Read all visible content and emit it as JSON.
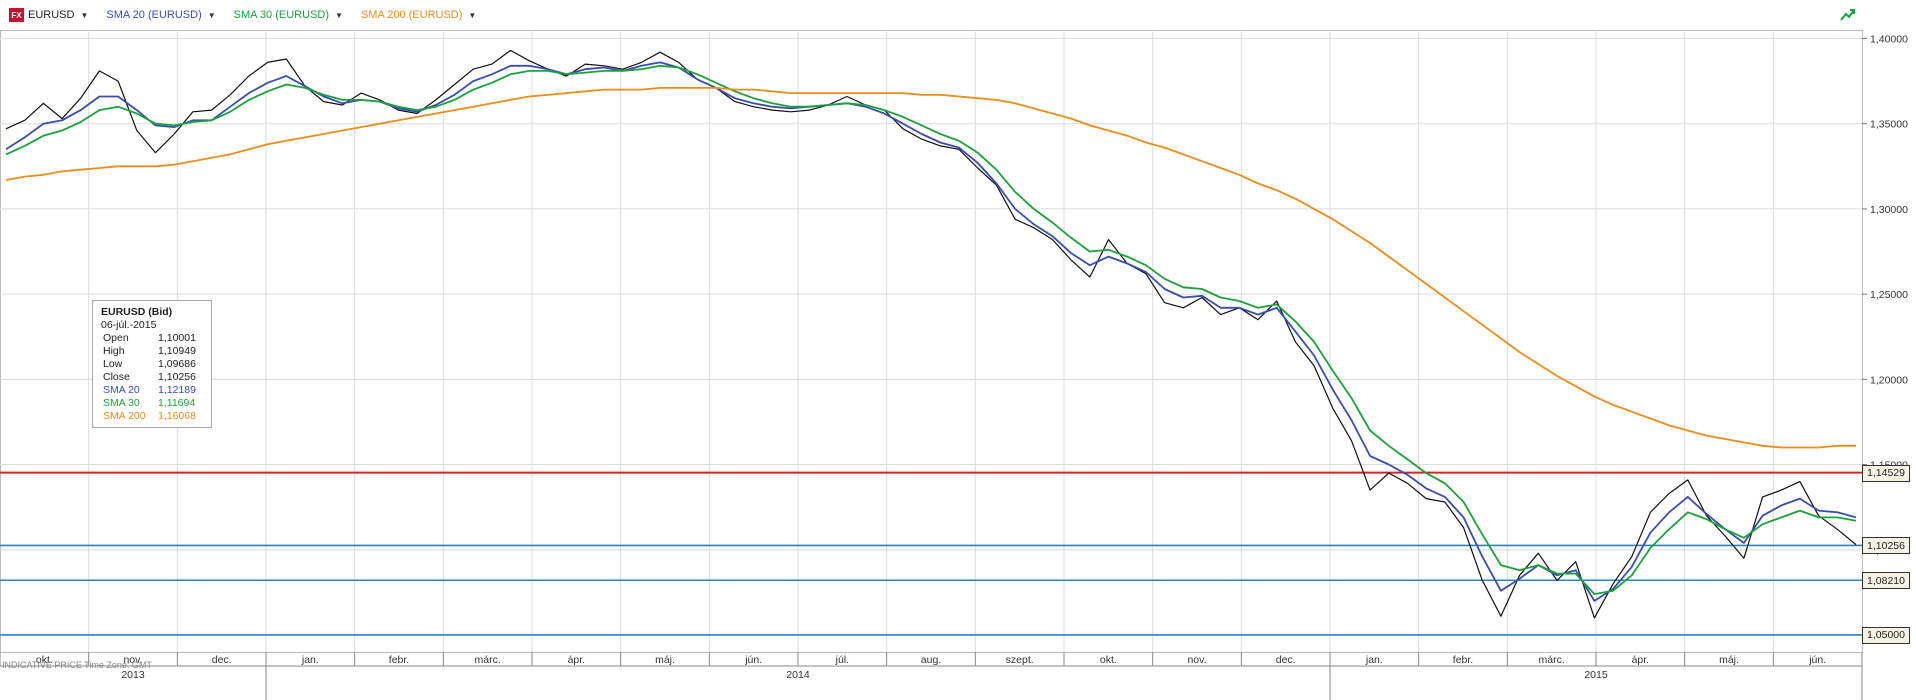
{
  "toolbar": {
    "symbol_icon": "fx-icon",
    "symbol": "EURUSD",
    "sma20_label": "SMA 20 (EURUSD)",
    "sma30_label": "SMA 30 (EURUSD)",
    "sma200_label": "SMA 200 (EURUSD)",
    "trend_icon": "trend-arrow-icon"
  },
  "colors": {
    "price": "#111111",
    "sma20": "#3a4db5",
    "sma30": "#1aa33a",
    "sma200": "#ee8c1a",
    "resistance": "#e02020",
    "support": "#2a84c0",
    "grid": "#dcdcdc"
  },
  "infobox": {
    "title": "EURUSD (Bid)",
    "date": "06-júl.-2015",
    "rows": [
      {
        "k": "Open",
        "v": "1,10001",
        "color": "#222222"
      },
      {
        "k": "High",
        "v": "1,10949",
        "color": "#222222"
      },
      {
        "k": "Low",
        "v": "1,09686",
        "color": "#222222"
      },
      {
        "k": "Close",
        "v": "1,10256",
        "color": "#222222"
      },
      {
        "k": "SMA 20",
        "v": "1,12189",
        "color": "#3a4db5"
      },
      {
        "k": "SMA 30",
        "v": "1,11694",
        "color": "#1aa33a"
      },
      {
        "k": "SMA 200",
        "v": "1,16068",
        "color": "#ee8c1a"
      }
    ]
  },
  "status_text": "INDICATIVE PRICE   Time Zone: GMT",
  "price_tags": [
    "1,14529",
    "1,10256",
    "1,08210",
    "1,05000"
  ],
  "chart_data": {
    "type": "line",
    "ylim": [
      1.04,
      1.405
    ],
    "y_ticks": [
      "1,40000",
      "1,35000",
      "1,30000",
      "1,25000",
      "1,20000",
      "1,15000",
      "1,10000",
      "1,05000"
    ],
    "y_tick_values": [
      1.4,
      1.35,
      1.3,
      1.25,
      1.2,
      1.15,
      1.1,
      1.05
    ],
    "months": [
      "okt.",
      "nov.",
      "dec.",
      "jan.",
      "febr.",
      "márc.",
      "ápr.",
      "máj.",
      "jún.",
      "júl.",
      "aug.",
      "szept.",
      "okt.",
      "nov.",
      "dec.",
      "jan.",
      "febr.",
      "márc.",
      "ápr.",
      "máj.",
      "jún."
    ],
    "years": [
      "2013",
      "2014",
      "2015"
    ],
    "horizontal_lines": [
      {
        "name": "resistance",
        "value": 1.14529,
        "color": "#e02020"
      },
      {
        "name": "last-close",
        "value": 1.10256,
        "color": "#2a84c0"
      },
      {
        "name": "support-1",
        "value": 1.0821,
        "color": "#2a84c0"
      },
      {
        "name": "support-2",
        "value": 1.05,
        "color": "#2a84c0"
      }
    ],
    "series": [
      {
        "key": "price",
        "values": [
          1.347,
          1.352,
          1.362,
          1.353,
          1.365,
          1.381,
          1.375,
          1.346,
          1.333,
          1.344,
          1.357,
          1.358,
          1.367,
          1.378,
          1.386,
          1.388,
          1.372,
          1.363,
          1.361,
          1.368,
          1.364,
          1.358,
          1.356,
          1.364,
          1.373,
          1.382,
          1.385,
          1.393,
          1.387,
          1.382,
          1.378,
          1.385,
          1.384,
          1.382,
          1.386,
          1.392,
          1.386,
          1.376,
          1.371,
          1.363,
          1.36,
          1.358,
          1.357,
          1.358,
          1.361,
          1.366,
          1.361,
          1.358,
          1.347,
          1.341,
          1.337,
          1.335,
          1.324,
          1.314,
          1.294,
          1.289,
          1.282,
          1.27,
          1.26,
          1.282,
          1.268,
          1.262,
          1.245,
          1.242,
          1.248,
          1.238,
          1.242,
          1.235,
          1.246,
          1.222,
          1.208,
          1.183,
          1.164,
          1.135,
          1.145,
          1.139,
          1.13,
          1.128,
          1.113,
          1.082,
          1.061,
          1.085,
          1.098,
          1.082,
          1.093,
          1.06,
          1.08,
          1.096,
          1.122,
          1.133,
          1.141,
          1.12,
          1.108,
          1.095,
          1.131,
          1.135,
          1.14,
          1.12,
          1.112,
          1.103
        ]
      },
      {
        "key": "sma20",
        "values": [
          1.335,
          1.342,
          1.35,
          1.352,
          1.358,
          1.366,
          1.366,
          1.358,
          1.349,
          1.348,
          1.352,
          1.352,
          1.36,
          1.368,
          1.374,
          1.378,
          1.372,
          1.366,
          1.362,
          1.364,
          1.363,
          1.359,
          1.357,
          1.361,
          1.367,
          1.375,
          1.379,
          1.384,
          1.384,
          1.382,
          1.379,
          1.382,
          1.383,
          1.381,
          1.384,
          1.386,
          1.383,
          1.376,
          1.371,
          1.365,
          1.362,
          1.36,
          1.359,
          1.36,
          1.361,
          1.362,
          1.36,
          1.356,
          1.35,
          1.344,
          1.339,
          1.336,
          1.327,
          1.315,
          1.3,
          1.291,
          1.284,
          1.274,
          1.267,
          1.272,
          1.268,
          1.263,
          1.253,
          1.248,
          1.249,
          1.242,
          1.242,
          1.238,
          1.242,
          1.228,
          1.214,
          1.194,
          1.176,
          1.155,
          1.15,
          1.144,
          1.136,
          1.131,
          1.119,
          1.096,
          1.076,
          1.083,
          1.091,
          1.085,
          1.088,
          1.07,
          1.077,
          1.09,
          1.11,
          1.122,
          1.131,
          1.121,
          1.112,
          1.104,
          1.12,
          1.126,
          1.13,
          1.123,
          1.122,
          1.119
        ]
      },
      {
        "key": "sma30",
        "values": [
          1.332,
          1.337,
          1.343,
          1.346,
          1.351,
          1.358,
          1.36,
          1.356,
          1.35,
          1.349,
          1.351,
          1.352,
          1.357,
          1.364,
          1.369,
          1.373,
          1.371,
          1.367,
          1.364,
          1.364,
          1.363,
          1.36,
          1.358,
          1.36,
          1.364,
          1.37,
          1.374,
          1.379,
          1.381,
          1.381,
          1.379,
          1.38,
          1.381,
          1.381,
          1.382,
          1.384,
          1.383,
          1.379,
          1.374,
          1.369,
          1.365,
          1.362,
          1.36,
          1.36,
          1.361,
          1.362,
          1.361,
          1.358,
          1.354,
          1.349,
          1.344,
          1.34,
          1.333,
          1.323,
          1.31,
          1.3,
          1.292,
          1.283,
          1.275,
          1.276,
          1.272,
          1.267,
          1.259,
          1.254,
          1.253,
          1.248,
          1.246,
          1.242,
          1.244,
          1.234,
          1.222,
          1.205,
          1.189,
          1.17,
          1.161,
          1.153,
          1.145,
          1.139,
          1.128,
          1.109,
          1.091,
          1.088,
          1.091,
          1.086,
          1.086,
          1.074,
          1.076,
          1.085,
          1.101,
          1.112,
          1.122,
          1.118,
          1.112,
          1.107,
          1.115,
          1.119,
          1.123,
          1.119,
          1.119,
          1.117
        ]
      },
      {
        "key": "sma200",
        "values": [
          1.317,
          1.319,
          1.32,
          1.322,
          1.323,
          1.324,
          1.325,
          1.325,
          1.325,
          1.326,
          1.328,
          1.33,
          1.332,
          1.335,
          1.338,
          1.34,
          1.342,
          1.344,
          1.346,
          1.348,
          1.35,
          1.352,
          1.354,
          1.356,
          1.358,
          1.36,
          1.362,
          1.364,
          1.366,
          1.367,
          1.368,
          1.369,
          1.37,
          1.37,
          1.37,
          1.371,
          1.371,
          1.371,
          1.371,
          1.37,
          1.37,
          1.369,
          1.368,
          1.368,
          1.368,
          1.368,
          1.368,
          1.368,
          1.368,
          1.367,
          1.367,
          1.366,
          1.365,
          1.364,
          1.362,
          1.359,
          1.356,
          1.353,
          1.349,
          1.346,
          1.343,
          1.339,
          1.336,
          1.332,
          1.328,
          1.324,
          1.32,
          1.315,
          1.311,
          1.306,
          1.3,
          1.294,
          1.287,
          1.28,
          1.272,
          1.264,
          1.256,
          1.248,
          1.24,
          1.232,
          1.224,
          1.216,
          1.209,
          1.202,
          1.196,
          1.19,
          1.185,
          1.181,
          1.177,
          1.173,
          1.17,
          1.167,
          1.165,
          1.163,
          1.161,
          1.16,
          1.16,
          1.16,
          1.161,
          1.161
        ]
      }
    ]
  }
}
